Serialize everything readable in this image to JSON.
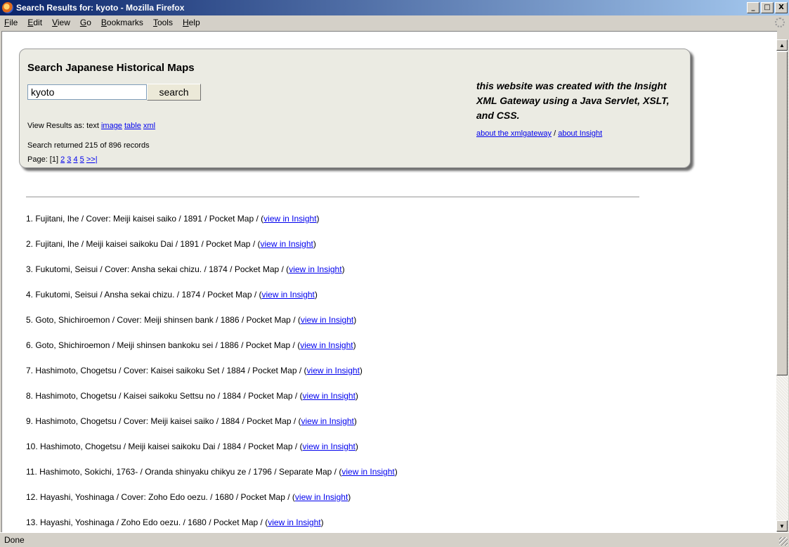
{
  "window": {
    "title": "Search Results for: kyoto - Mozilla Firefox",
    "minimize": "_",
    "maximize": "□",
    "close": "X"
  },
  "menu": {
    "file": {
      "u": "F",
      "rest": "ile"
    },
    "edit": {
      "u": "E",
      "rest": "dit"
    },
    "view": {
      "u": "V",
      "rest": "iew"
    },
    "go": {
      "u": "G",
      "rest": "o"
    },
    "bookmarks": {
      "u": "B",
      "rest": "ookmarks"
    },
    "tools": {
      "u": "T",
      "rest": "ools"
    },
    "help": {
      "u": "H",
      "rest": "elp"
    }
  },
  "search": {
    "heading": "Search Japanese Historical Maps",
    "query": "kyoto",
    "button": "search",
    "view_as_prefix": "View Results as: text",
    "view_image": "image",
    "view_table": "table",
    "view_xml": "xml",
    "returned": "Search returned 215 of 896 records",
    "page_prefix": "Page: [1]",
    "pages": [
      "2",
      "3",
      "4",
      "5",
      ">>|"
    ]
  },
  "about": {
    "text": "this website was created with the Insight XML Gateway using a Java Servlet, XSLT, and CSS.",
    "link_xmlgateway": "about the xmlgateway",
    "separator": "/",
    "link_insight": "about Insight"
  },
  "results": [
    {
      "text": "1. Fujitani, Ihe / Cover: Meiji kaisei saiko / 1891 / Pocket Map / (",
      "link": "view in Insight",
      "close": ")"
    },
    {
      "text": "2. Fujitani, Ihe / Meiji kaisei saikoku Dai / 1891 / Pocket Map / (",
      "link": "view in Insight",
      "close": ")"
    },
    {
      "text": "3. Fukutomi, Seisui / Cover: Ansha sekai chizu. / 1874 / Pocket Map / (",
      "link": "view in Insight",
      "close": ")"
    },
    {
      "text": "4. Fukutomi, Seisui / Ansha sekai chizu. / 1874 / Pocket Map / (",
      "link": "view in Insight",
      "close": ")"
    },
    {
      "text": "5. Goto, Shichiroemon / Cover: Meiji shinsen bank / 1886 / Pocket Map / (",
      "link": "view in Insight",
      "close": ")"
    },
    {
      "text": "6. Goto, Shichiroemon / Meiji shinsen bankoku sei / 1886 / Pocket Map / (",
      "link": "view in Insight",
      "close": ")"
    },
    {
      "text": "7. Hashimoto, Chogetsu / Cover: Kaisei saikoku Set / 1884 / Pocket Map / (",
      "link": "view in Insight",
      "close": ")"
    },
    {
      "text": "8. Hashimoto, Chogetsu / Kaisei saikoku Settsu no / 1884 / Pocket Map / (",
      "link": "view in Insight",
      "close": ")"
    },
    {
      "text": "9. Hashimoto, Chogetsu / Cover: Meiji kaisei saiko / 1884 / Pocket Map / (",
      "link": "view in Insight",
      "close": ")"
    },
    {
      "text": "10. Hashimoto, Chogetsu / Meiji kaisei saikoku Dai / 1884 / Pocket Map / (",
      "link": "view in Insight",
      "close": ")"
    },
    {
      "text": "11. Hashimoto, Sokichi, 1763- / Oranda shinyaku chikyu ze / 1796 / Separate Map / (",
      "link": "view in Insight",
      "close": ")"
    },
    {
      "text": "12. Hayashi, Yoshinaga / Cover: Zoho Edo oezu. / 1680 / Pocket Map / (",
      "link": "view in Insight",
      "close": ")"
    },
    {
      "text": "13. Hayashi, Yoshinaga / Zoho Edo oezu. / 1680 / Pocket Map / (",
      "link": "view in Insight",
      "close": ")"
    }
  ],
  "status": "Done",
  "icons": {
    "app": "firefox-icon",
    "throbber": "throbber-icon",
    "scroll_up": "scroll-up-arrow-icon",
    "scroll_down": "scroll-down-arrow-icon",
    "resize": "resize-grip-icon"
  },
  "colors": {
    "link": "#0000ee",
    "panel": "#ebebe3",
    "titlebar": "#0a246a"
  }
}
